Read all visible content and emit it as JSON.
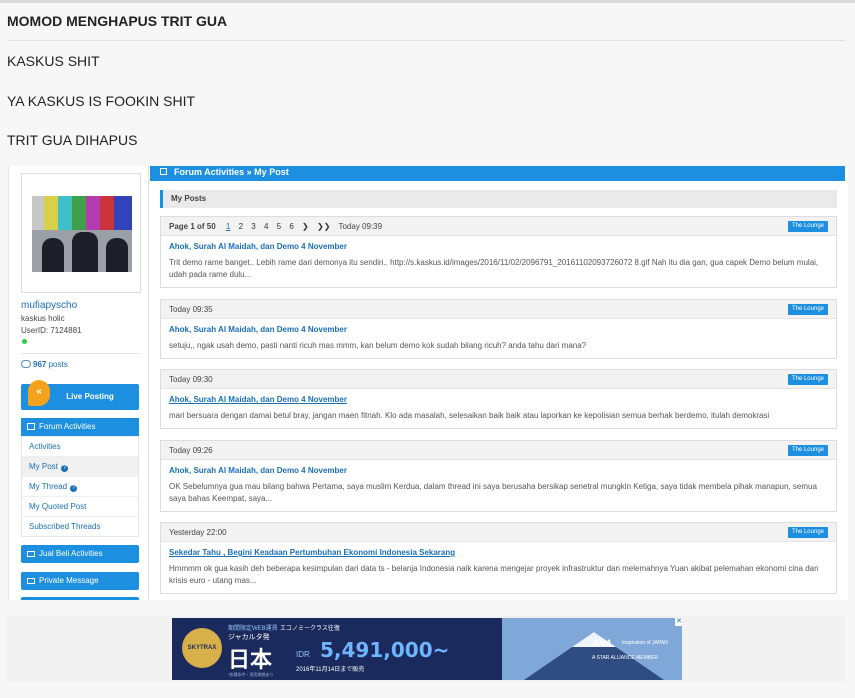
{
  "post": {
    "title": "MOMOD MENGHAPUS TRIT GUA",
    "lines": [
      "KASKUS SHIT",
      "YA KASKUS IS FOOKIN SHIT",
      "TRIT GUA DIHAPUS"
    ]
  },
  "profile": {
    "username": "mufiapyscho",
    "user_title": "kaskus holic",
    "user_id": "UserID: 7124881",
    "posts_count": "967",
    "posts_label": "posts",
    "live_posting_label": "Live Posting"
  },
  "side_menu": {
    "header": "Forum Activities",
    "items": [
      "Activities",
      "My Post",
      "My Thread",
      "My Quoted Post",
      "Subscribed Threads"
    ],
    "jual_beli": "Jual Beli Activities",
    "private_message": "Private Message"
  },
  "main": {
    "breadcrumb": "Forum Activities » My Post",
    "section_title": "My Posts",
    "pagination": {
      "label": "Page 1 of 50",
      "pages": [
        "1",
        "2",
        "3",
        "4",
        "5",
        "6"
      ],
      "next": "❯",
      "last": "❯❯"
    },
    "posts": [
      {
        "time": "Today 09:39",
        "badge": "The Lounge",
        "title": "Ahok, Surah Al Maidah, dan Demo 4 November",
        "body": "Trit demo rame banget.. Lebih rame dari demonya itu sendiri.. http://s.kaskus.id/images/2016/11/02/2096791_20161102093726072 8.gif Nah itu dia gan, gua capek Demo belum mulai, udah pada rame dulu..."
      },
      {
        "time": "Today 09:35",
        "badge": "The Lounge",
        "title": "Ahok, Surah Al Maidah, dan Demo 4 November",
        "body": "setuju,, ngak usah demo, pasti nanti ricuh mas mmm, kan belum demo kok sudah bilang ricuh? anda tahu dari mana?"
      },
      {
        "time": "Today 09:30",
        "badge": "The Lounge",
        "title": "Ahok, Surah Al Maidah, dan Demo 4 November",
        "body": "mari bersuara dengan damai betul bray, jangan maen fitnah. Klo ada masalah, selesaikan baik baik atau laporkan ke kepolisian semua berhak berdemo, itulah demokrasi"
      },
      {
        "time": "Today 09:26",
        "badge": "The Lounge",
        "title": "Ahok, Surah Al Maidah, dan Demo 4 November",
        "body": "OK Sebelumnya gua mau bilang bahwa Pertama, saya muslim Kerdua, dalam thread ini saya berusaha bersikap senetral mungkin Ketiga, saya tidak membela pihak manapun, semua saya bahas Keempat, saya..."
      },
      {
        "time": "Yesterday 22:00",
        "badge": "The Lounge",
        "title": "Sekedar Tahu , Begini Keadaan Pertumbuhan Ekonomi Indonesia Sekarang",
        "body": "Hmmmm ok gua kasih deh beberapa kesimpulan dari data ts - belanja Indonesia naik karena mengejar proyek infrastruktur dan melemahnya Yuan akibat pelemahan ekonomi cina dan krisis euro - utang mas..."
      }
    ]
  },
  "ad": {
    "badge": "SKYTRAX",
    "small1": "期間限定WEB運賃",
    "small2": "ジャカルタ発",
    "big": "日本",
    "caption": "エコノミークラス往復",
    "currency": "IDR",
    "price": "5,491,000~",
    "date": "2016年11月14日まで販売",
    "fine": "*各種条件・適用期間あり",
    "airline": "ANA",
    "tagline": "Inspiration of JAPAN",
    "alliance": "A STAR ALLIANCE MEMBER",
    "close": "✕"
  }
}
